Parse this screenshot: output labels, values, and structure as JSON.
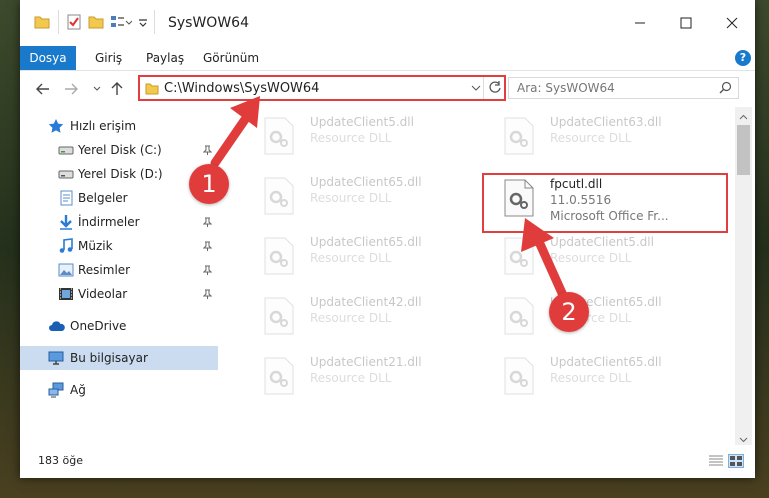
{
  "window": {
    "title": "SysWOW64"
  },
  "ribbon": {
    "tabs": [
      "Dosya",
      "Giriş",
      "Paylaş",
      "Görünüm"
    ],
    "help_label": "?"
  },
  "address": {
    "path": "C:\\Windows\\SysWOW64",
    "search_placeholder": "Ara: SysWOW64"
  },
  "nav": {
    "items": [
      {
        "label": "Hızlı erişim",
        "icon": "star-icon"
      },
      {
        "label": "Yerel Disk (C:)",
        "icon": "drive-icon"
      },
      {
        "label": "Yerel Disk (D:)",
        "icon": "drive-icon"
      },
      {
        "label": "Belgeler",
        "icon": "documents-icon"
      },
      {
        "label": "İndirmeler",
        "icon": "download-icon"
      },
      {
        "label": "Müzik",
        "icon": "music-icon"
      },
      {
        "label": "Resimler",
        "icon": "pictures-icon"
      },
      {
        "label": "Videolar",
        "icon": "video-icon"
      },
      {
        "label": "OneDrive",
        "icon": "cloud-icon"
      },
      {
        "label": "Bu bilgisayar",
        "icon": "computer-icon"
      },
      {
        "label": "Ağ",
        "icon": "network-icon"
      }
    ]
  },
  "files": {
    "left": [
      {
        "name": "UpdateClient5.dll",
        "type": "Resource DLL"
      },
      {
        "name": "UpdateClient65.dll",
        "type": "Resource DLL"
      },
      {
        "name": "UpdateClient65.dll",
        "type": "Resource DLL"
      },
      {
        "name": "UpdateClient42.dll",
        "type": "Resource DLL"
      },
      {
        "name": "UpdateClient21.dll",
        "type": "Resource DLL"
      }
    ],
    "right": [
      {
        "name": "UpdateClient63.dll",
        "type": "Resource DLL"
      },
      {
        "name": "UpdateClient5.dll",
        "type": "Resource DLL"
      },
      {
        "name": "UpdateClient65.dll",
        "type": "Resource DLL"
      },
      {
        "name": "UpdateClient65.dll",
        "type": "Resource DLL"
      }
    ],
    "highlighted": {
      "name": "fpcutl.dll",
      "version": "11.0.5516",
      "description": "Microsoft Office Fr..."
    }
  },
  "status": {
    "count": "183 öğe"
  },
  "callouts": [
    "1",
    "2"
  ],
  "colors": {
    "accent": "#1979ca",
    "highlight": "#e03f3f",
    "selected": "#ccdcf0"
  }
}
